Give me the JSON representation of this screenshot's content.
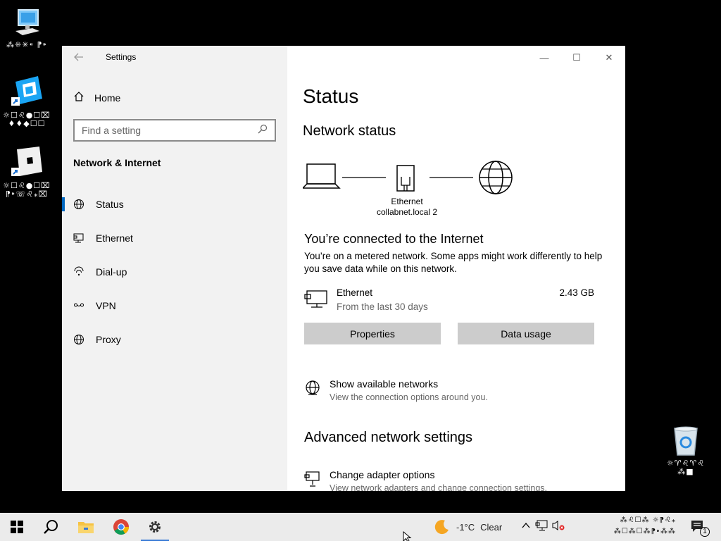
{
  "desktop": {
    "icons": [
      {
        "label": "⁂⁜✳⁌ ⁋⁍"
      },
      {
        "label": "☼☐♌●☐⌧\n♦♦◆☐☐"
      },
      {
        "label": "☼☐♌●☐⌧\n⁋⁍☏♌⁎⌧"
      },
      {
        "label": "☼♈♌♈♌\n⁂■"
      }
    ]
  },
  "window": {
    "title": "Settings",
    "minimize": "—",
    "maximize": "☐",
    "close": "✕"
  },
  "sidebar": {
    "home": "Home",
    "search_placeholder": "Find a setting",
    "section": "Network & Internet",
    "items": [
      {
        "label": "Status",
        "icon": "globe-icon",
        "active": true
      },
      {
        "label": "Ethernet",
        "icon": "ethernet-icon"
      },
      {
        "label": "Dial-up",
        "icon": "dialup-icon"
      },
      {
        "label": "VPN",
        "icon": "vpn-icon"
      },
      {
        "label": "Proxy",
        "icon": "globe-icon"
      }
    ]
  },
  "content": {
    "title": "Status",
    "network_status": "Network status",
    "diagram": {
      "adapter": "Ethernet",
      "network": "collabnet.local 2"
    },
    "connected_title": "You’re connected to the Internet",
    "connected_desc": "You’re on a metered network. Some apps might work differently to help you save data while on this network.",
    "network": {
      "name": "Ethernet",
      "sub": "From the last 30 days",
      "usage": "2.43 GB"
    },
    "buttons": {
      "properties": "Properties",
      "data_usage": "Data usage"
    },
    "show_networks": {
      "title": "Show available networks",
      "desc": "View the connection options around you."
    },
    "advanced_title": "Advanced network settings",
    "adapter_options": {
      "title": "Change adapter options",
      "desc": "View network adapters and change connection settings."
    }
  },
  "taskbar": {
    "weather_temp": "-1°C",
    "weather_desc": "Clear",
    "clock_line1": "⁂♌☐⁂ ☼⁋♌⁎",
    "clock_line2": "⁂☐⁂☐⁂⁋⁍⁂⁂",
    "notifications": "1"
  },
  "colors": {
    "accent": "#0067c0",
    "sidebar_bg": "#f2f2f2",
    "button_bg": "#cccccc"
  }
}
